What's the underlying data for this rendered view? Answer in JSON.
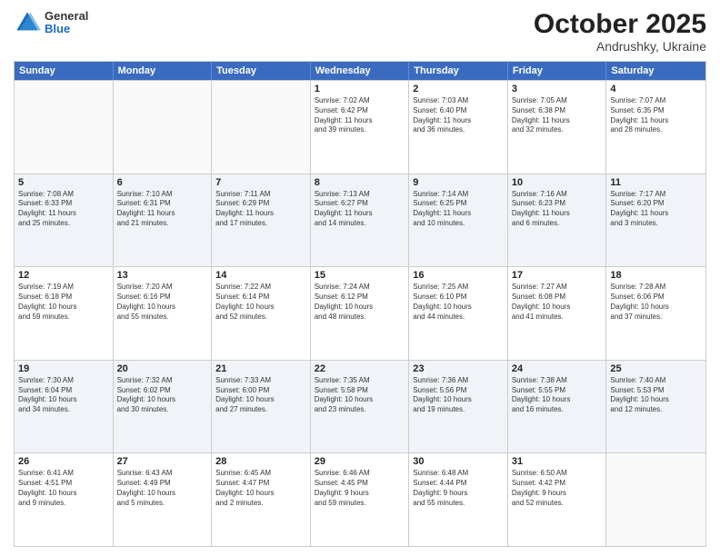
{
  "header": {
    "logo_general": "General",
    "logo_blue": "Blue",
    "month": "October 2025",
    "location": "Andrushky, Ukraine"
  },
  "weekdays": [
    "Sunday",
    "Monday",
    "Tuesday",
    "Wednesday",
    "Thursday",
    "Friday",
    "Saturday"
  ],
  "rows": [
    [
      {
        "day": "",
        "text": "",
        "empty": true
      },
      {
        "day": "",
        "text": "",
        "empty": true
      },
      {
        "day": "",
        "text": "",
        "empty": true
      },
      {
        "day": "1",
        "text": "Sunrise: 7:02 AM\nSunset: 6:42 PM\nDaylight: 11 hours\nand 39 minutes."
      },
      {
        "day": "2",
        "text": "Sunrise: 7:03 AM\nSunset: 6:40 PM\nDaylight: 11 hours\nand 36 minutes."
      },
      {
        "day": "3",
        "text": "Sunrise: 7:05 AM\nSunset: 6:38 PM\nDaylight: 11 hours\nand 32 minutes."
      },
      {
        "day": "4",
        "text": "Sunrise: 7:07 AM\nSunset: 6:35 PM\nDaylight: 11 hours\nand 28 minutes."
      }
    ],
    [
      {
        "day": "5",
        "text": "Sunrise: 7:08 AM\nSunset: 6:33 PM\nDaylight: 11 hours\nand 25 minutes."
      },
      {
        "day": "6",
        "text": "Sunrise: 7:10 AM\nSunset: 6:31 PM\nDaylight: 11 hours\nand 21 minutes."
      },
      {
        "day": "7",
        "text": "Sunrise: 7:11 AM\nSunset: 6:29 PM\nDaylight: 11 hours\nand 17 minutes."
      },
      {
        "day": "8",
        "text": "Sunrise: 7:13 AM\nSunset: 6:27 PM\nDaylight: 11 hours\nand 14 minutes."
      },
      {
        "day": "9",
        "text": "Sunrise: 7:14 AM\nSunset: 6:25 PM\nDaylight: 11 hours\nand 10 minutes."
      },
      {
        "day": "10",
        "text": "Sunrise: 7:16 AM\nSunset: 6:23 PM\nDaylight: 11 hours\nand 6 minutes."
      },
      {
        "day": "11",
        "text": "Sunrise: 7:17 AM\nSunset: 6:20 PM\nDaylight: 11 hours\nand 3 minutes."
      }
    ],
    [
      {
        "day": "12",
        "text": "Sunrise: 7:19 AM\nSunset: 6:18 PM\nDaylight: 10 hours\nand 59 minutes."
      },
      {
        "day": "13",
        "text": "Sunrise: 7:20 AM\nSunset: 6:16 PM\nDaylight: 10 hours\nand 55 minutes."
      },
      {
        "day": "14",
        "text": "Sunrise: 7:22 AM\nSunset: 6:14 PM\nDaylight: 10 hours\nand 52 minutes."
      },
      {
        "day": "15",
        "text": "Sunrise: 7:24 AM\nSunset: 6:12 PM\nDaylight: 10 hours\nand 48 minutes."
      },
      {
        "day": "16",
        "text": "Sunrise: 7:25 AM\nSunset: 6:10 PM\nDaylight: 10 hours\nand 44 minutes."
      },
      {
        "day": "17",
        "text": "Sunrise: 7:27 AM\nSunset: 6:08 PM\nDaylight: 10 hours\nand 41 minutes."
      },
      {
        "day": "18",
        "text": "Sunrise: 7:28 AM\nSunset: 6:06 PM\nDaylight: 10 hours\nand 37 minutes."
      }
    ],
    [
      {
        "day": "19",
        "text": "Sunrise: 7:30 AM\nSunset: 6:04 PM\nDaylight: 10 hours\nand 34 minutes."
      },
      {
        "day": "20",
        "text": "Sunrise: 7:32 AM\nSunset: 6:02 PM\nDaylight: 10 hours\nand 30 minutes."
      },
      {
        "day": "21",
        "text": "Sunrise: 7:33 AM\nSunset: 6:00 PM\nDaylight: 10 hours\nand 27 minutes."
      },
      {
        "day": "22",
        "text": "Sunrise: 7:35 AM\nSunset: 5:58 PM\nDaylight: 10 hours\nand 23 minutes."
      },
      {
        "day": "23",
        "text": "Sunrise: 7:36 AM\nSunset: 5:56 PM\nDaylight: 10 hours\nand 19 minutes."
      },
      {
        "day": "24",
        "text": "Sunrise: 7:38 AM\nSunset: 5:55 PM\nDaylight: 10 hours\nand 16 minutes."
      },
      {
        "day": "25",
        "text": "Sunrise: 7:40 AM\nSunset: 5:53 PM\nDaylight: 10 hours\nand 12 minutes."
      }
    ],
    [
      {
        "day": "26",
        "text": "Sunrise: 6:41 AM\nSunset: 4:51 PM\nDaylight: 10 hours\nand 9 minutes."
      },
      {
        "day": "27",
        "text": "Sunrise: 6:43 AM\nSunset: 4:49 PM\nDaylight: 10 hours\nand 5 minutes."
      },
      {
        "day": "28",
        "text": "Sunrise: 6:45 AM\nSunset: 4:47 PM\nDaylight: 10 hours\nand 2 minutes."
      },
      {
        "day": "29",
        "text": "Sunrise: 6:46 AM\nSunset: 4:45 PM\nDaylight: 9 hours\nand 59 minutes."
      },
      {
        "day": "30",
        "text": "Sunrise: 6:48 AM\nSunset: 4:44 PM\nDaylight: 9 hours\nand 55 minutes."
      },
      {
        "day": "31",
        "text": "Sunrise: 6:50 AM\nSunset: 4:42 PM\nDaylight: 9 hours\nand 52 minutes."
      },
      {
        "day": "",
        "text": "",
        "empty": true
      }
    ]
  ]
}
